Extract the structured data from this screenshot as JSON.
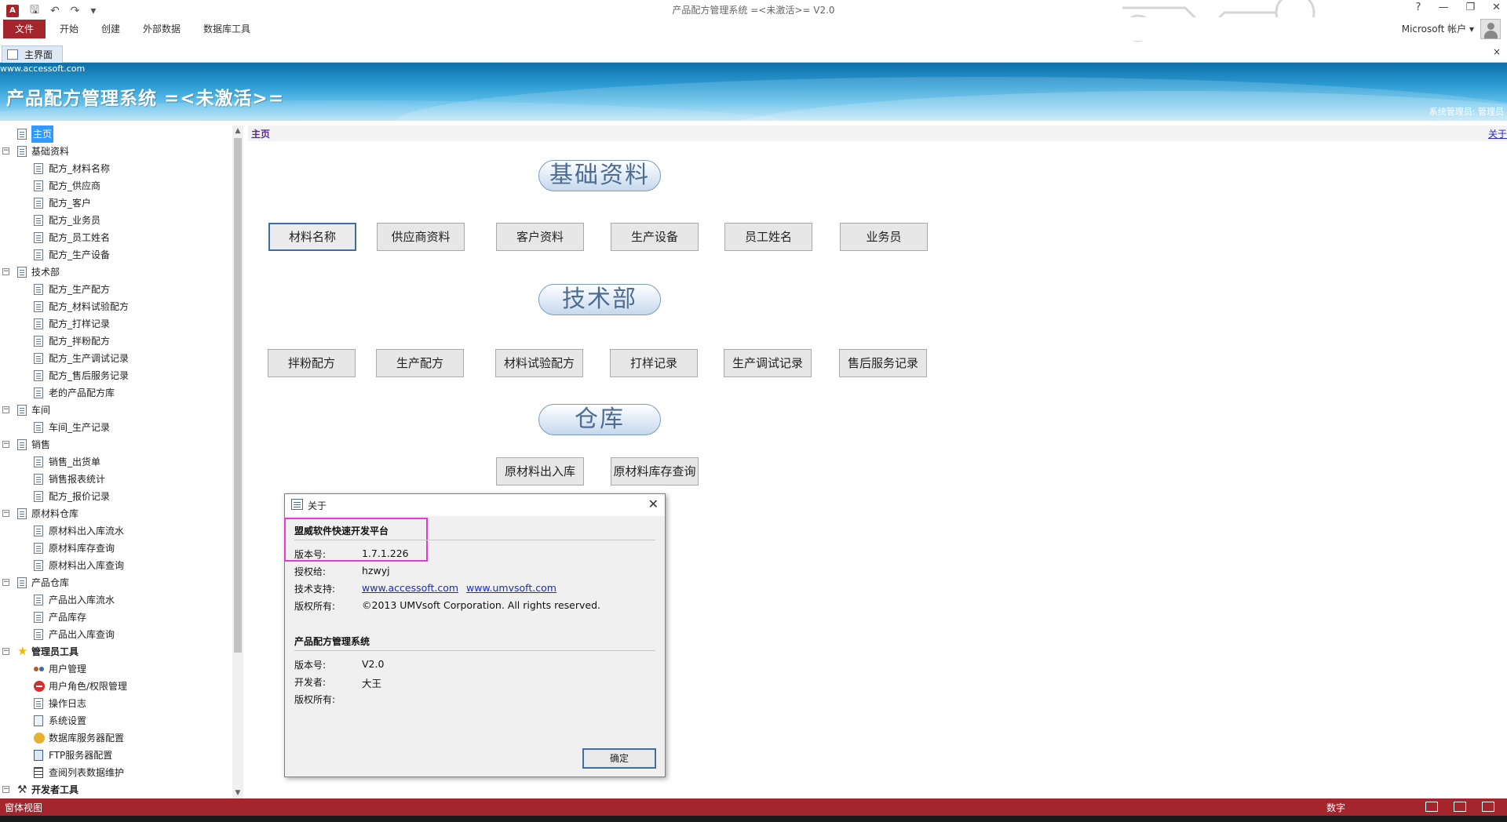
{
  "window": {
    "title": "产品配方管理系统 =<未激活>= V2.0",
    "account": "Microsoft 帐户",
    "app_logo": "A",
    "controls": [
      "?",
      "—",
      "❐",
      "✕"
    ]
  },
  "ribbon": {
    "tabs": [
      "文件",
      "开始",
      "创建",
      "外部数据",
      "数据库工具"
    ]
  },
  "doc_tab": {
    "label": "主界面",
    "close": "×"
  },
  "banner": {
    "url": "www.accessoft.com",
    "title": "产品配方管理系统 =<未激活>=",
    "user": "系统管理员: 管理员"
  },
  "tree": [
    {
      "label": "主页",
      "level": 0,
      "expander": "",
      "selected": true
    },
    {
      "label": "基础资料",
      "level": 0,
      "expander": "⊟"
    },
    {
      "label": "配方_材料名称",
      "level": 1
    },
    {
      "label": "配方_供应商",
      "level": 1
    },
    {
      "label": "配方_客户",
      "level": 1
    },
    {
      "label": "配方_业务员",
      "level": 1
    },
    {
      "label": "配方_员工姓名",
      "level": 1
    },
    {
      "label": "配方_生产设备",
      "level": 1
    },
    {
      "label": "技术部",
      "level": 0,
      "expander": "⊟"
    },
    {
      "label": "配方_生产配方",
      "level": 1
    },
    {
      "label": "配方_材料试验配方",
      "level": 1
    },
    {
      "label": "配方_打样记录",
      "level": 1
    },
    {
      "label": "配方_拌粉配方",
      "level": 1
    },
    {
      "label": "配方_生产调试记录",
      "level": 1
    },
    {
      "label": "配方_售后服务记录",
      "level": 1
    },
    {
      "label": "老的产品配方库",
      "level": 1
    },
    {
      "label": "车间",
      "level": 0,
      "expander": "⊟"
    },
    {
      "label": "车间_生产记录",
      "level": 1
    },
    {
      "label": "销售",
      "level": 0,
      "expander": "⊟"
    },
    {
      "label": "销售_出货单",
      "level": 1
    },
    {
      "label": "销售报表统计",
      "level": 1
    },
    {
      "label": "配方_报价记录",
      "level": 1
    },
    {
      "label": "原材料仓库",
      "level": 0,
      "expander": "⊟"
    },
    {
      "label": "原材料出入库流水",
      "level": 1
    },
    {
      "label": "原材料库存查询",
      "level": 1
    },
    {
      "label": "原材料出入库查询",
      "level": 1
    },
    {
      "label": "产品仓库",
      "level": 0,
      "expander": "⊟"
    },
    {
      "label": "产品出入库流水",
      "level": 1
    },
    {
      "label": "产品库存",
      "level": 1
    },
    {
      "label": "产品出入库查询",
      "level": 1
    },
    {
      "label": "管理员工具",
      "level": 0,
      "expander": "⊟",
      "icon": "star-icon",
      "bold": true
    },
    {
      "label": "用户管理",
      "level": 1,
      "icon": "users-icon"
    },
    {
      "label": "用户角色/权限管理",
      "level": 1,
      "icon": "stop-icon"
    },
    {
      "label": "操作日志",
      "level": 1
    },
    {
      "label": "系统设置",
      "level": 1,
      "icon": "gear-icon"
    },
    {
      "label": "数据库服务器配置",
      "level": 1,
      "icon": "database-icon"
    },
    {
      "label": "FTP服务器配置",
      "level": 1,
      "icon": "ftp-icon"
    },
    {
      "label": "查阅列表数据维护",
      "level": 1,
      "icon": "grid-icon"
    },
    {
      "label": "开发者工具",
      "level": 0,
      "expander": "⊟",
      "icon": "tools-icon",
      "bold": true
    }
  ],
  "content": {
    "breadcrumb": "主页",
    "about_link": "关于",
    "sections": [
      {
        "title": "基础资料",
        "buttons": [
          "材料名称",
          "供应商资料",
          "客户资料",
          "生产设备",
          "员工姓名",
          "业务员"
        ]
      },
      {
        "title": "技术部",
        "buttons": [
          "拌粉配方",
          "生产配方",
          "材料试验配方",
          "打样记录",
          "生产调试记录",
          "售后服务记录"
        ]
      },
      {
        "title": "仓库",
        "buttons": [
          "原材料出入库",
          "原材料库存查询"
        ]
      }
    ]
  },
  "dialog": {
    "title": "关于",
    "platform_heading": "盟威软件快速开发平台",
    "platform_version_label": "版本号:",
    "platform_version": "1.7.1.226",
    "licensed_label": "授权给:",
    "licensed_to": "hzwyj",
    "support_label": "技术支持:",
    "support_link1": "www.accessoft.com",
    "support_link2": "www.umvsoft.com",
    "copyright_label": "版权所有:",
    "copyright": "©2013 UMVsoft Corporation. All rights reserved.",
    "app_heading": "产品配方管理系统",
    "app_version_label": "版本号:",
    "app_version": "V2.0",
    "developer_label": "开发者:",
    "developer": "大王",
    "app_copyright_label": "版权所有:",
    "app_copyright": "",
    "ok_label": "确定",
    "highlight_color": "#e23ad6"
  },
  "status": {
    "left": "窗体视图",
    "right": "数字"
  },
  "colors": {
    "accent": "#a4262c",
    "banner": "#2a9ad3",
    "selection": "#3399ff"
  }
}
